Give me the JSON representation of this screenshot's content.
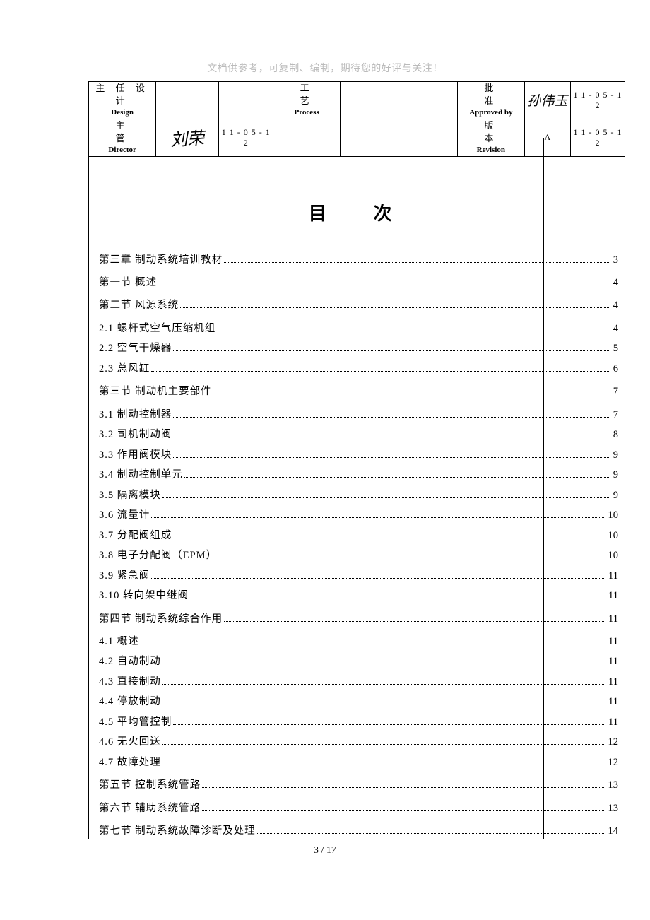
{
  "top_note": "文档供参考，可复制、编制，期待您的好评与关注！",
  "header": {
    "row1": {
      "left_label_cn": "主 任 设 计",
      "left_label_en": "Design",
      "mid_label_cn": "工　　　艺",
      "mid_label_en": "Process",
      "right_label_cn": "批　　　准",
      "right_label_en": "Approved by",
      "right_sig": "孙伟玉",
      "right_date": "1 1 - 0 5 - 1 2"
    },
    "row2": {
      "left_label_cn": "主　　　管",
      "left_label_en": "Director",
      "left_sig": "刘荣",
      "left_date": "1 1 - 0 5 - 1 2",
      "right_label_cn": "版　　　本",
      "right_label_en": "Revision",
      "right_rev": "A",
      "right_date": "1 1 - 0 5 - 1 2"
    }
  },
  "toc_title": "目　次",
  "toc": [
    {
      "label": "第三章 制动系统培训教材",
      "page": "3",
      "section": true
    },
    {
      "label": "第一节 概述",
      "page": "4",
      "section": true
    },
    {
      "label": "第二节 风源系统",
      "page": "4",
      "section": true
    },
    {
      "label": "2.1 螺杆式空气压缩机组",
      "page": "4"
    },
    {
      "label": "2.2 空气干燥器",
      "page": "5"
    },
    {
      "label": "2.3 总风缸",
      "page": "6"
    },
    {
      "label": "第三节 制动机主要部件",
      "page": "7",
      "section": true
    },
    {
      "label": "3.1 制动控制器",
      "page": "7"
    },
    {
      "label": "3.2 司机制动阀",
      "page": "8"
    },
    {
      "label": "3.3 作用阀模块",
      "page": "9"
    },
    {
      "label": "3.4 制动控制单元",
      "page": "9"
    },
    {
      "label": "3.5 隔离模块",
      "page": "9"
    },
    {
      "label": "3.6 流量计",
      "page": "10"
    },
    {
      "label": "3.7 分配阀组成",
      "page": "10"
    },
    {
      "label": "3.8 电子分配阀（EPM）",
      "page": "10"
    },
    {
      "label": "3.9 紧急阀",
      "page": "11"
    },
    {
      "label": "3.10 转向架中继阀",
      "page": "11"
    },
    {
      "label": "第四节 制动系统综合作用",
      "page": "11",
      "section": true
    },
    {
      "label": "4.1 概述",
      "page": "11"
    },
    {
      "label": "4.2 自动制动",
      "page": "11"
    },
    {
      "label": "4.3 直接制动",
      "page": "11"
    },
    {
      "label": "4.4 停放制动",
      "page": "11"
    },
    {
      "label": "4.5 平均管控制",
      "page": "11"
    },
    {
      "label": "4.6 无火回送",
      "page": "12"
    },
    {
      "label": "4.7 故障处理",
      "page": "12"
    },
    {
      "label": "第五节 控制系统管路",
      "page": "13",
      "section": true
    },
    {
      "label": "第六节 辅助系统管路",
      "page": "13",
      "section": true
    },
    {
      "label": "第七节 制动系统故障诊断及处理",
      "page": "14",
      "section": true
    }
  ],
  "pager": "3 / 17"
}
